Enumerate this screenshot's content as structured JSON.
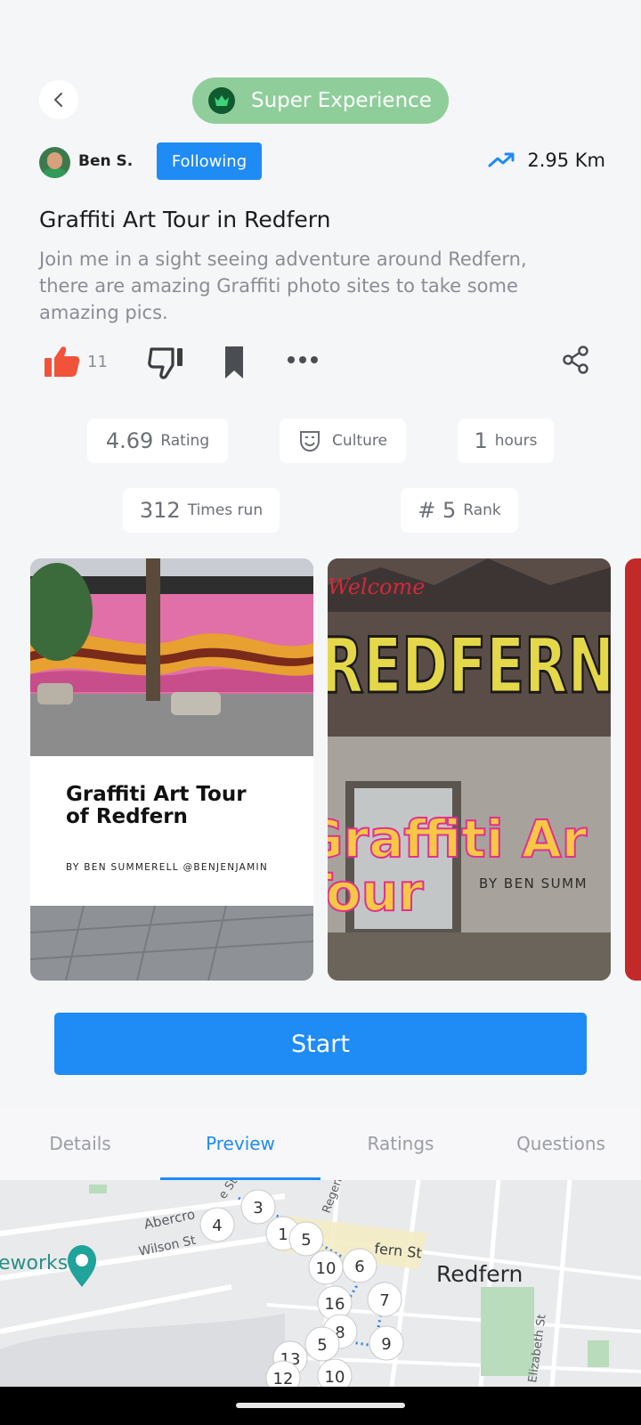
{
  "header": {
    "badge_label": "Super Experience"
  },
  "author": {
    "name": "Ben S.",
    "follow_label": "Following",
    "distance": "2.95 Km"
  },
  "tour": {
    "title": "Graffiti Art Tour in Redfern",
    "description": "Join me in a sight seeing adventure around Redfern, there are amazing Graffiti photo sites to take some amazing pics."
  },
  "actions": {
    "like_count": "11"
  },
  "stats": {
    "rating_value": "4.69",
    "rating_label": "Rating",
    "category": "Culture",
    "duration_value": "1",
    "duration_label": "hours",
    "runs_value": "312",
    "runs_label": "Times run",
    "rank_value": "# 5",
    "rank_label": "Rank"
  },
  "gallery": {
    "card1_title": "Graffiti Art Tour of Redfern",
    "card1_byline": "BY BEN SUMMERELL @BENJENJAMIN",
    "card2_welcome": "Welcome",
    "card2_sign": "REDFERN",
    "card2_overlay": "Graffiti Art Tour",
    "card2_byline": "BY BEN SUMM"
  },
  "start_label": "Start",
  "tabs": [
    "Details",
    "Preview",
    "Ratings",
    "Questions"
  ],
  "active_tab": "Preview",
  "map": {
    "labels": {
      "abercrombie": "Abercro",
      "wilson": "Wilson St",
      "regent": "Regen",
      "redfern_st": "fern St",
      "redfern": "Redfern",
      "elizabeth": "Elizabeth St",
      "works": "eworks",
      "st_top": "e St"
    },
    "markers": [
      "3",
      "4",
      "1",
      "5",
      "10",
      "6",
      "16",
      "7",
      "8",
      "5",
      "9",
      "13",
      "12",
      "10"
    ]
  },
  "colors": {
    "accent": "#1f8bf5",
    "badge_bg": "#8fce9a",
    "like": "#f0533a"
  }
}
